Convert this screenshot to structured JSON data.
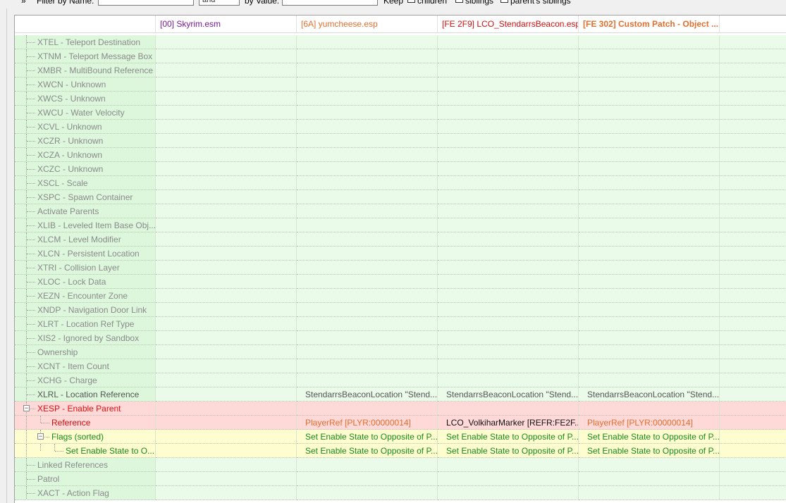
{
  "filter": {
    "name_label": "Filter by Name:",
    "name_value": "",
    "op_value": "and",
    "value_label": "by Value:",
    "value_value": "",
    "keep_label": "Keep",
    "children_label": "children",
    "siblings_label": "siblings",
    "parent_siblings_label": "parent's siblings"
  },
  "columns": [
    {
      "label": "[00] Skyrim.esm",
      "color": "#7a1a9a"
    },
    {
      "label": "[6A] yumcheese.esp",
      "color": "#e07030"
    },
    {
      "label": "[FE 2F9] LCO_StendarrsBeacon.esp",
      "color": "#d01010"
    },
    {
      "label": "[FE 302] Custom Patch - Object ...",
      "color": "#e07030"
    }
  ],
  "rows": [
    {
      "name": "XTEL - Teleport Destination",
      "values": [
        "",
        "",
        "",
        ""
      ]
    },
    {
      "name": "XTNM - Teleport Message Box",
      "values": [
        "",
        "",
        "",
        ""
      ]
    },
    {
      "name": "XMBR - MultiBound Reference",
      "values": [
        "",
        "",
        "",
        ""
      ]
    },
    {
      "name": "XWCN - Unknown",
      "values": [
        "",
        "",
        "",
        ""
      ]
    },
    {
      "name": "XWCS - Unknown",
      "values": [
        "",
        "",
        "",
        ""
      ]
    },
    {
      "name": "XWCU - Water Velocity",
      "values": [
        "",
        "",
        "",
        ""
      ]
    },
    {
      "name": "XCVL - Unknown",
      "values": [
        "",
        "",
        "",
        ""
      ]
    },
    {
      "name": "XCZR - Unknown",
      "values": [
        "",
        "",
        "",
        ""
      ]
    },
    {
      "name": "XCZA - Unknown",
      "values": [
        "",
        "",
        "",
        ""
      ]
    },
    {
      "name": "XCZC - Unknown",
      "values": [
        "",
        "",
        "",
        ""
      ]
    },
    {
      "name": "XSCL - Scale",
      "values": [
        "",
        "",
        "",
        ""
      ]
    },
    {
      "name": "XSPC - Spawn Container",
      "values": [
        "",
        "",
        "",
        ""
      ]
    },
    {
      "name": "Activate Parents",
      "values": [
        "",
        "",
        "",
        ""
      ]
    },
    {
      "name": "XLIB - Leveled Item Base Obj...",
      "values": [
        "",
        "",
        "",
        ""
      ]
    },
    {
      "name": "XLCM - Level Modifier",
      "values": [
        "",
        "",
        "",
        ""
      ]
    },
    {
      "name": "XLCN - Persistent Location",
      "values": [
        "",
        "",
        "",
        ""
      ]
    },
    {
      "name": "XTRI - Collision Layer",
      "values": [
        "",
        "",
        "",
        ""
      ]
    },
    {
      "name": "XLOC - Lock Data",
      "values": [
        "",
        "",
        "",
        ""
      ]
    },
    {
      "name": "XEZN - Encounter Zone",
      "values": [
        "",
        "",
        "",
        ""
      ]
    },
    {
      "name": "XNDP - Navigation Door Link",
      "values": [
        "",
        "",
        "",
        ""
      ]
    },
    {
      "name": "XLRT - Location Ref Type",
      "values": [
        "",
        "",
        "",
        ""
      ]
    },
    {
      "name": "XIS2 - Ignored by Sandbox",
      "values": [
        "",
        "",
        "",
        ""
      ]
    },
    {
      "name": "Ownership",
      "values": [
        "",
        "",
        "",
        ""
      ]
    },
    {
      "name": "XCNT - Item Count",
      "values": [
        "",
        "",
        "",
        ""
      ]
    },
    {
      "name": "XCHG - Charge",
      "values": [
        "",
        "",
        "",
        ""
      ]
    },
    {
      "name": "XLRL - Location Reference",
      "values": [
        "",
        "StendarrsBeaconLocation \"Stend...",
        "StendarrsBeaconLocation \"Stend...",
        "StendarrsBeaconLocation \"Stend..."
      ],
      "style": "xlrl"
    },
    {
      "name": "XESP - Enable Parent",
      "values": [
        "",
        "",
        "",
        ""
      ],
      "style": "xesp",
      "expander": "minus"
    },
    {
      "name": "Reference",
      "values": [
        "",
        "PlayerRef [PLYR:00000014]",
        "LCO_VolkiharMarker [REFR:FE2F...",
        "PlayerRef [PLYR:00000014]"
      ],
      "style": "ref",
      "indent": 1
    },
    {
      "name": "Flags (sorted)",
      "values": [
        "",
        "Set Enable State to Opposite of P...",
        "Set Enable State to Opposite of P...",
        "Set Enable State to Opposite of P..."
      ],
      "style": "flags",
      "indent": 1,
      "expander": "minus"
    },
    {
      "name": "Set Enable State to O...",
      "values": [
        "",
        "Set Enable State to Opposite of P...",
        "Set Enable State to Opposite of P...",
        "Set Enable State to Opposite of P..."
      ],
      "style": "flags",
      "indent": 2
    },
    {
      "name": "Linked References",
      "values": [
        "",
        "",
        "",
        ""
      ]
    },
    {
      "name": "Patrol",
      "values": [
        "",
        "",
        "",
        ""
      ]
    },
    {
      "name": "XACT - Action Flag",
      "values": [
        "",
        "",
        "",
        ""
      ]
    }
  ],
  "colors": {
    "default_name_bg": "#dcf7dc",
    "default_val_bg": "#eafbea",
    "xesp_bg": "#ffd8d8",
    "xesp_name_color": "#e01010",
    "ref_name_color": "#d01010",
    "flags_bg": "#fdfdd0",
    "flags_color": "#1a8a1a",
    "ref_orange": "#e07030",
    "ref_red": "#d01010"
  }
}
